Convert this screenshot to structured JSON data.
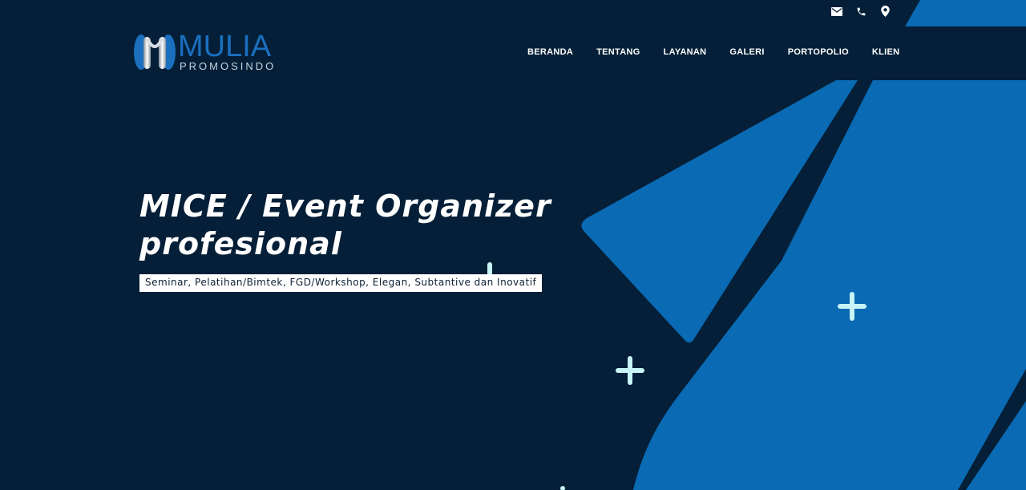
{
  "topbar": {
    "icons": [
      "envelope-icon",
      "phone-icon",
      "map-marker-icon"
    ]
  },
  "brand": {
    "name": "MULIA",
    "tagline": "PROMOSINDO"
  },
  "nav": {
    "items": [
      "BERANDA",
      "TENTANG",
      "LAYANAN",
      "GALERI",
      "PORTOPOLIO",
      "KLIEN"
    ]
  },
  "hero": {
    "title": "MICE / Event Organizer profesional",
    "subtitle": "Seminar, Pelatihan/Bimtek, FGD/Workshop, Elegan, Subtantive dan Inovatif"
  },
  "colors": {
    "background": "#041f37",
    "accent_blue": "#0a6ab3",
    "brand_blue": "#1b6fbf",
    "plus_icon": "#c8f4f7"
  }
}
